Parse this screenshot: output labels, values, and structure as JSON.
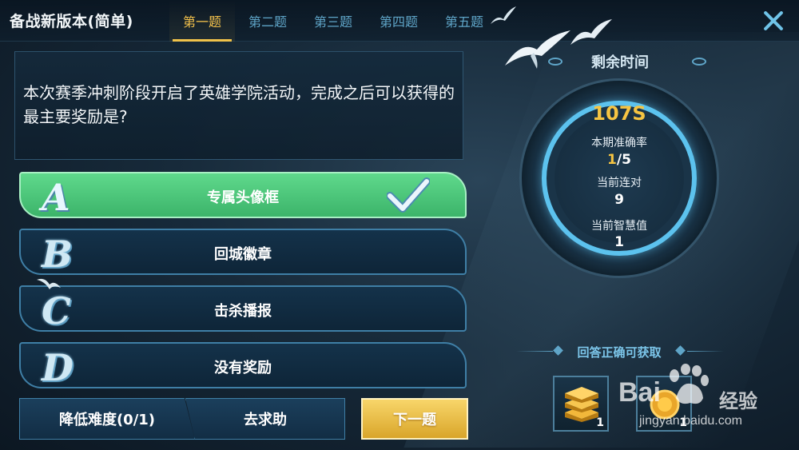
{
  "header": {
    "title": "备战新版本(简单)",
    "tabs": [
      {
        "label": "第一题",
        "active": true
      },
      {
        "label": "第二题",
        "active": false
      },
      {
        "label": "第三题",
        "active": false
      },
      {
        "label": "第四题",
        "active": false
      },
      {
        "label": "第五题",
        "active": false
      }
    ],
    "close_icon": "close-icon"
  },
  "question": {
    "text": "本次赛季冲刺阶段开启了英雄学院活动，完成之后可以获得的最主要奖励是?"
  },
  "options": [
    {
      "letter": "A",
      "text": "专属头像框",
      "state": "correct"
    },
    {
      "letter": "B",
      "text": "回城徽章",
      "state": "normal"
    },
    {
      "letter": "C",
      "text": "击杀播报",
      "state": "normal"
    },
    {
      "letter": "D",
      "text": "没有奖励",
      "state": "normal"
    }
  ],
  "buttons": {
    "lower_difficulty": "降低难度(0/1)",
    "ask_help": "去求助",
    "next": "下一题"
  },
  "timer": {
    "label": "剩余时间",
    "value": "107S"
  },
  "stats": {
    "accuracy_label": "本期准确率",
    "accuracy_correct": "1",
    "accuracy_total": "/5",
    "streak_label": "当前连对",
    "streak_value": "9",
    "wisdom_label": "当前智慧值",
    "wisdom_value": "1"
  },
  "rewards": {
    "title": "回答正确可获取",
    "items": [
      {
        "icon": "book-stack-icon",
        "count": "1"
      },
      {
        "icon": "coin-icon",
        "count": "1"
      }
    ]
  },
  "watermark": {
    "brand": "Bai",
    "cn": "经验",
    "url": "jingyan.baidu.com"
  },
  "colors": {
    "accent_gold": "#f6c442",
    "correct_green": "#4cc77a",
    "tab_blue": "#5fa5c8",
    "ring_blue": "#5cc2ee"
  }
}
